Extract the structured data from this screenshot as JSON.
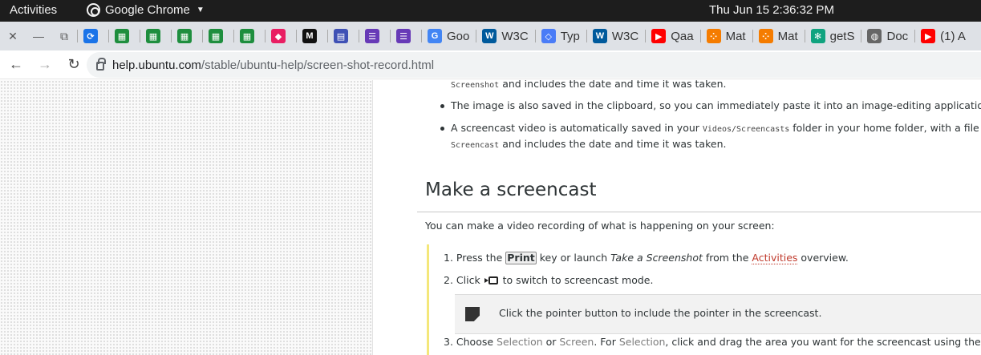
{
  "topbar": {
    "activities": "Activities",
    "app_name": "Google Chrome",
    "clock": "Thu Jun 15   2:36:32 PM"
  },
  "tabs": [
    {
      "label": "",
      "icon": "sync-icon",
      "color": "#1a73e8"
    },
    {
      "label": "",
      "icon": "sheets-icon",
      "color": "#1e8e3e"
    },
    {
      "label": "",
      "icon": "sheets-icon",
      "color": "#1e8e3e"
    },
    {
      "label": "",
      "icon": "sheets-icon",
      "color": "#1e8e3e"
    },
    {
      "label": "",
      "icon": "sheets-icon",
      "color": "#1e8e3e"
    },
    {
      "label": "",
      "icon": "sheets-icon",
      "color": "#1e8e3e"
    },
    {
      "label": "",
      "icon": "cube-icon",
      "color": "#e91e63"
    },
    {
      "label": "",
      "icon": "m-icon",
      "color": "#111111"
    },
    {
      "label": "",
      "icon": "dashboard-icon",
      "color": "#3f51b5"
    },
    {
      "label": "",
      "icon": "forms-icon",
      "color": "#673ab7"
    },
    {
      "label": "",
      "icon": "forms-icon",
      "color": "#673ab7"
    },
    {
      "label": "Goo",
      "icon": "translate-icon",
      "color": "#4285f4"
    },
    {
      "label": "W3C",
      "icon": "w3-icon",
      "color": "#005a9c"
    },
    {
      "label": "Typ",
      "icon": "diamond-icon",
      "color": "#4a7cf7"
    },
    {
      "label": "W3C",
      "icon": "w3-icon",
      "color": "#005a9c"
    },
    {
      "label": "Qaa",
      "icon": "youtube-icon",
      "color": "#ff0000"
    },
    {
      "label": "Mat",
      "icon": "dots-icon",
      "color": "#f57c00"
    },
    {
      "label": "Mat",
      "icon": "dots-icon",
      "color": "#f57c00"
    },
    {
      "label": "getS",
      "icon": "openai-icon",
      "color": "#10a37f"
    },
    {
      "label": "Doc",
      "icon": "globe-icon",
      "color": "#666666"
    },
    {
      "label": "(1) A",
      "icon": "youtube-icon",
      "color": "#ff0000"
    }
  ],
  "omnibox": {
    "host": "help.ubuntu.com",
    "path": "/stable/ubuntu-help/screen-shot-record.html"
  },
  "content": {
    "bullet1_tail_code": "Screenshot",
    "bullet1_tail_text": " and includes the date and time it was taken.",
    "bullet2": "The image is also saved in the clipboard, so you can immediately paste it into an image-editing application or share",
    "bullet3_text_a": "A screencast video is automatically saved in your ",
    "bullet3_code": "Videos/Screencasts",
    "bullet3_text_b": " folder in your home folder, with a file name",
    "bullet3_tail_code": "Screencast",
    "bullet3_tail_text": " and includes the date and time it was taken.",
    "heading": "Make a screencast",
    "intro": "You can make a video recording of what is happening on your screen:",
    "step1_a": "1. Press the ",
    "step1_key": "Print",
    "step1_b": " key or launch ",
    "step1_em": "Take a Screenshot",
    "step1_c": " from the ",
    "step1_link": "Activities",
    "step1_d": " overview.",
    "step2_a": "2. Click ",
    "step2_b": " to switch to screencast mode.",
    "note": "Click the pointer button to include the pointer in the screencast.",
    "step3_a": "3. Choose ",
    "step3_gui1": "Selection",
    "step3_b": " or ",
    "step3_gui2": "Screen",
    "step3_c": ". For ",
    "step3_gui3": "Selection",
    "step3_d": ", click and drag the area you want for the screencast using the handles"
  }
}
